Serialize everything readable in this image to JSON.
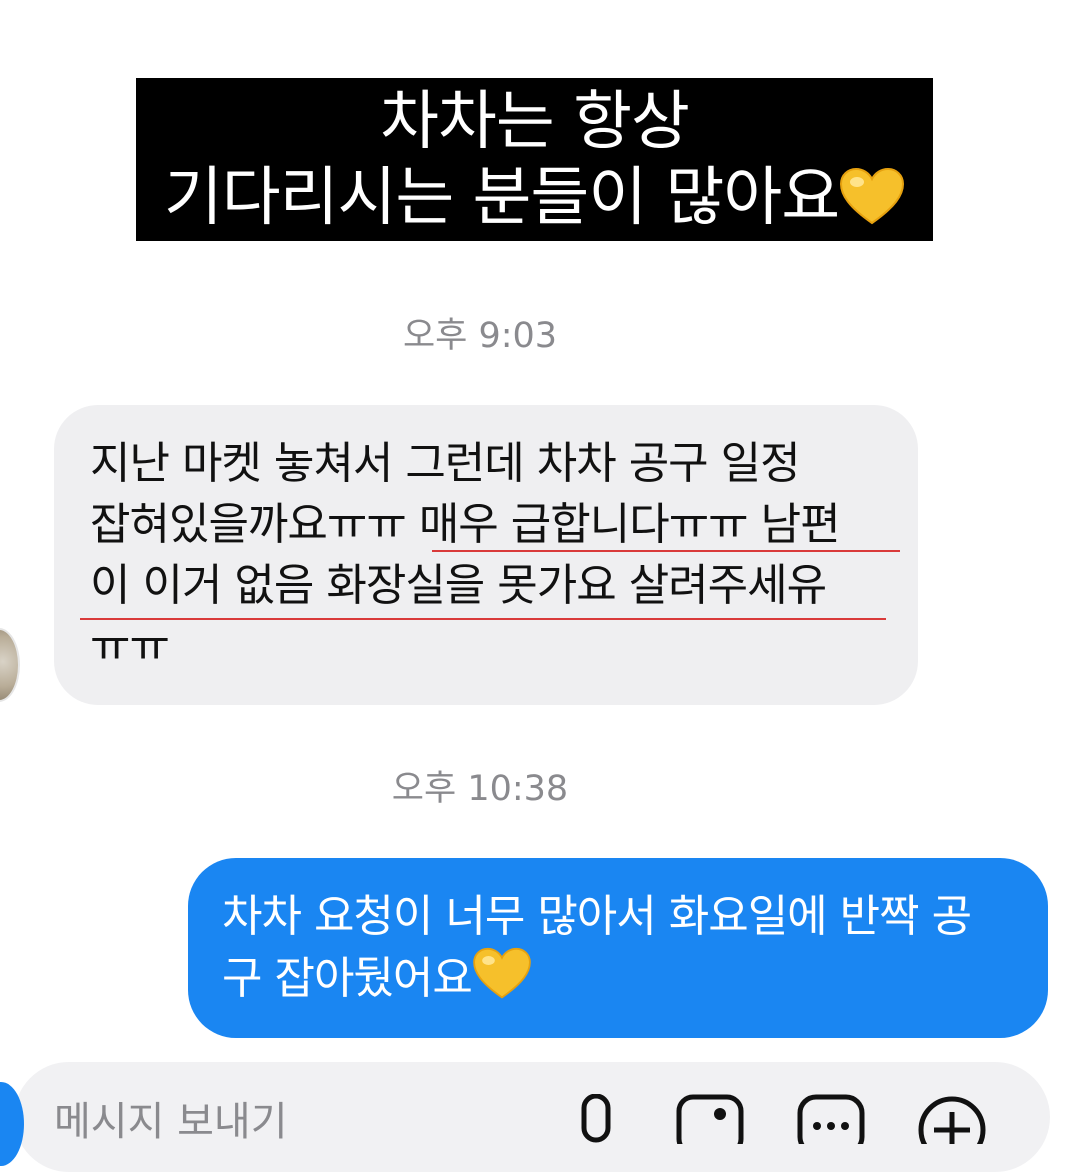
{
  "caption": {
    "line1": "차차는 항상",
    "line2": "기다리시는 분들이 많아요",
    "emoji": "yellow-heart"
  },
  "thread": {
    "timestamp1": "오후 9:03",
    "incoming": {
      "lines": [
        "지난 마켓 놓쳐서 그런데 차차 공구 일정",
        "잡혀있을까요ㅠㅠ 매우 급합니다ㅠㅠ 남편",
        "이 이거 없음 화장실을 못가요 살려주세유",
        "ㅠㅠ"
      ],
      "underline_color": "#d93a3a"
    },
    "timestamp2": "오후 10:38",
    "outgoing": {
      "lines": [
        "차차 요청이 너무 많아서 화요일에 반짝 공",
        "구 잡아뒀어요"
      ],
      "emoji": "yellow-heart"
    }
  },
  "composer": {
    "placeholder": "메시지 보내기",
    "icons": [
      "camera-icon",
      "microphone-icon",
      "gallery-icon",
      "sticker-icon",
      "plus-icon"
    ]
  },
  "colors": {
    "outgoing_bubble": "#1a86f2",
    "incoming_bubble": "#efeff1",
    "caption_bg": "#000000",
    "timestamp": "#8a8a8e"
  }
}
